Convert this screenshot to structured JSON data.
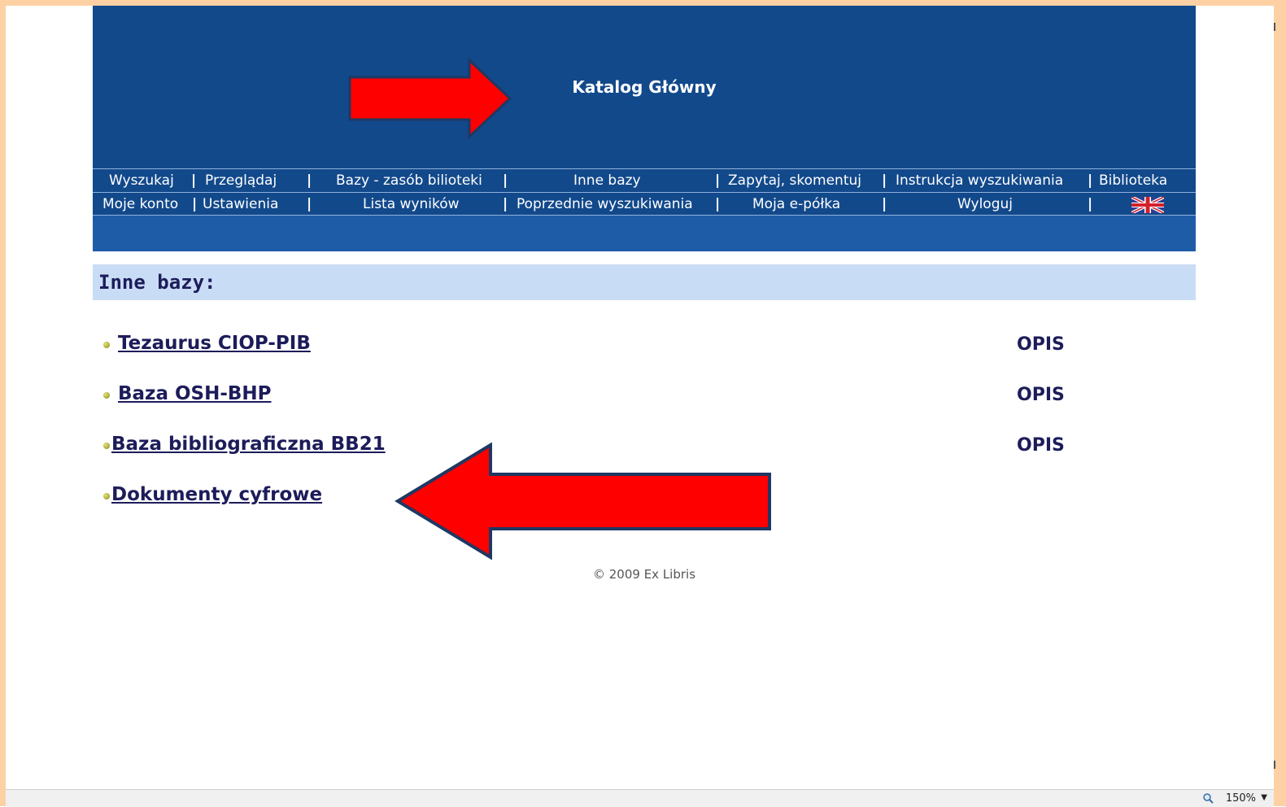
{
  "banner": {
    "title": "Katalog Główny"
  },
  "menu": {
    "row1": [
      "Wyszukaj",
      "Przeglądaj",
      "Bazy - zasób bilioteki",
      "Inne bazy",
      "Zapytaj, skomentuj",
      "Instrukcja wyszukiwania",
      "Biblioteka"
    ],
    "row2": [
      "Moje konto",
      "Ustawienia",
      "Lista wyników",
      "Poprzednie wyszukiwania",
      "Moja e-półka",
      "Wyloguj"
    ],
    "separator": "|"
  },
  "section": {
    "title": "Inne bazy:"
  },
  "databases": [
    {
      "label": "Tezaurus CIOP-PIB",
      "opis": "OPIS"
    },
    {
      "label": "Baza OSH-BHP",
      "opis": "OPIS"
    },
    {
      "label": "Baza bibliograficzna BB21",
      "opis": "OPIS"
    },
    {
      "label": "Dokumenty cyfrowe"
    }
  ],
  "footer": {
    "copyright": "© 2009 Ex Libris"
  },
  "status": {
    "zoom": "150%"
  },
  "icons": {
    "language": "uk-flag-icon",
    "zoom": "zoom-icon"
  },
  "colors": {
    "banner": "#12498b",
    "strip": "#1f5ca8",
    "section": "#c9dcf5",
    "link": "#1d1c5a",
    "arrow": "#ff0000",
    "frame": "#fdd1a4"
  }
}
